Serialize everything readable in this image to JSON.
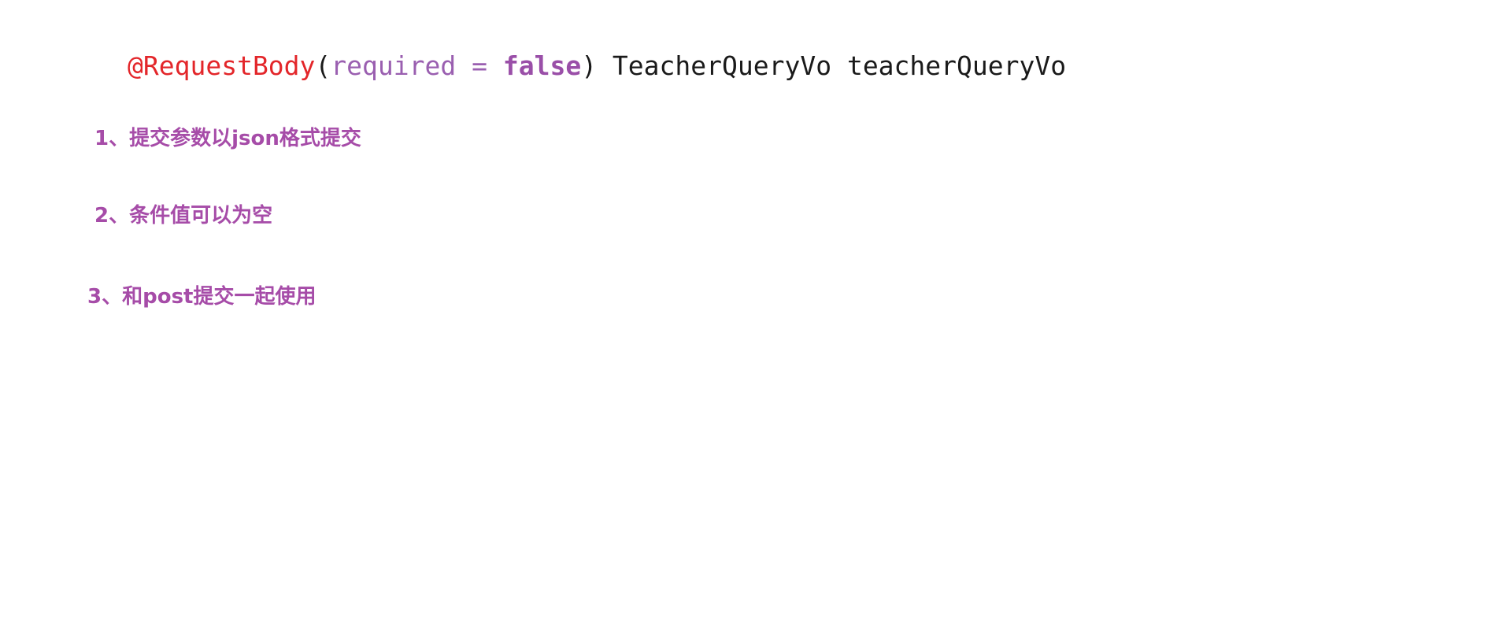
{
  "code": {
    "annotation": "@RequestBody",
    "open_paren": "(",
    "param": "required = ",
    "keyword": "false",
    "close_paren": ")",
    "type_and_var": " TeacherQueryVo teacherQueryVo"
  },
  "notes": [
    "1、提交参数以json格式提交",
    "2、条件值可以为空",
    "3、和post提交一起使用"
  ],
  "colors": {
    "annotation": "#e3262a",
    "param": "#9a5fb0",
    "keyword": "#9a4fa8",
    "note": "#a64ca8",
    "text": "#1a1a1a"
  }
}
